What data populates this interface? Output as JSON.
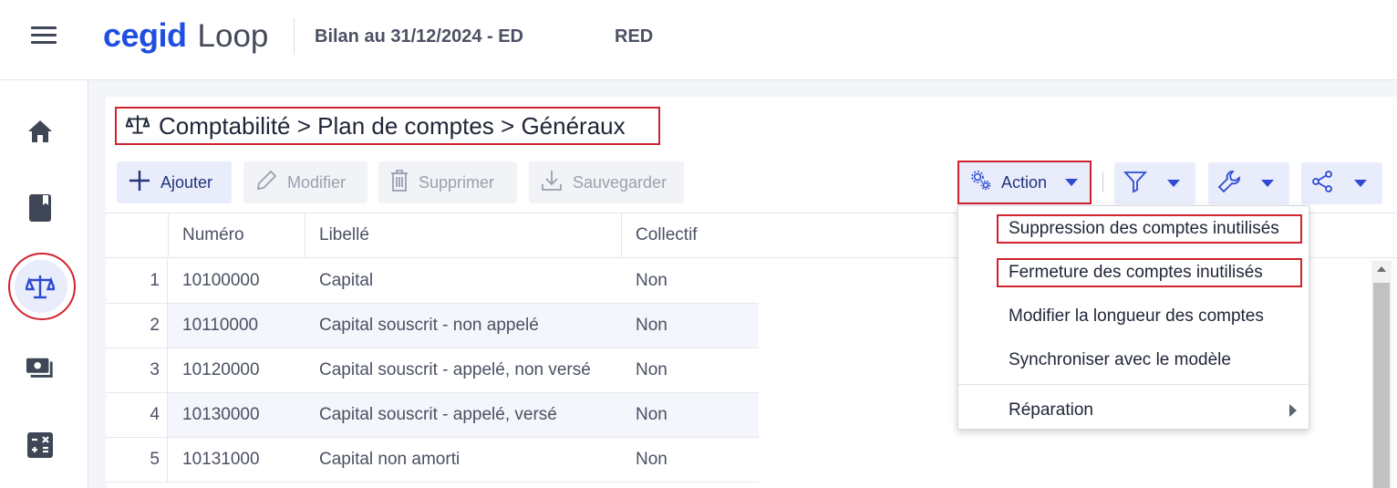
{
  "header": {
    "logo_brand": "cegid",
    "logo_product": "Loop",
    "document_title": "Bilan au 31/12/2024 - ED",
    "company": "RED"
  },
  "sidebar": {
    "items": [
      {
        "icon": "home-icon"
      },
      {
        "icon": "book-icon"
      },
      {
        "icon": "scale-icon",
        "active": true
      },
      {
        "icon": "money-icon"
      },
      {
        "icon": "calculator-icon"
      }
    ]
  },
  "breadcrumb": {
    "text": "Comptabilité > Plan de comptes > Généraux"
  },
  "toolbar": {
    "add": "Ajouter",
    "edit": "Modifier",
    "delete": "Supprimer",
    "save": "Sauvegarder",
    "action": "Action"
  },
  "table": {
    "columns": [
      "Numéro",
      "Libellé",
      "Collectif"
    ],
    "rows": [
      {
        "n": "1",
        "numero": "10100000",
        "libelle": "Capital",
        "collectif": "Non"
      },
      {
        "n": "2",
        "numero": "10110000",
        "libelle": "Capital souscrit - non appelé",
        "collectif": "Non"
      },
      {
        "n": "3",
        "numero": "10120000",
        "libelle": "Capital souscrit - appelé, non versé",
        "collectif": "Non"
      },
      {
        "n": "4",
        "numero": "10130000",
        "libelle": "Capital souscrit - appelé, versé",
        "collectif": "Non"
      },
      {
        "n": "5",
        "numero": "10131000",
        "libelle": "Capital non amorti",
        "collectif": "Non"
      }
    ]
  },
  "action_menu": {
    "items": [
      "Suppression des comptes inutilisés",
      "Fermeture des comptes inutilisés",
      "Modifier la longueur des comptes",
      "Synchroniser avec le modèle",
      "Réparation"
    ]
  },
  "colors": {
    "brand": "#1f4fe0",
    "accent_bg": "#e8ecfb",
    "highlight": "#d0232f"
  }
}
